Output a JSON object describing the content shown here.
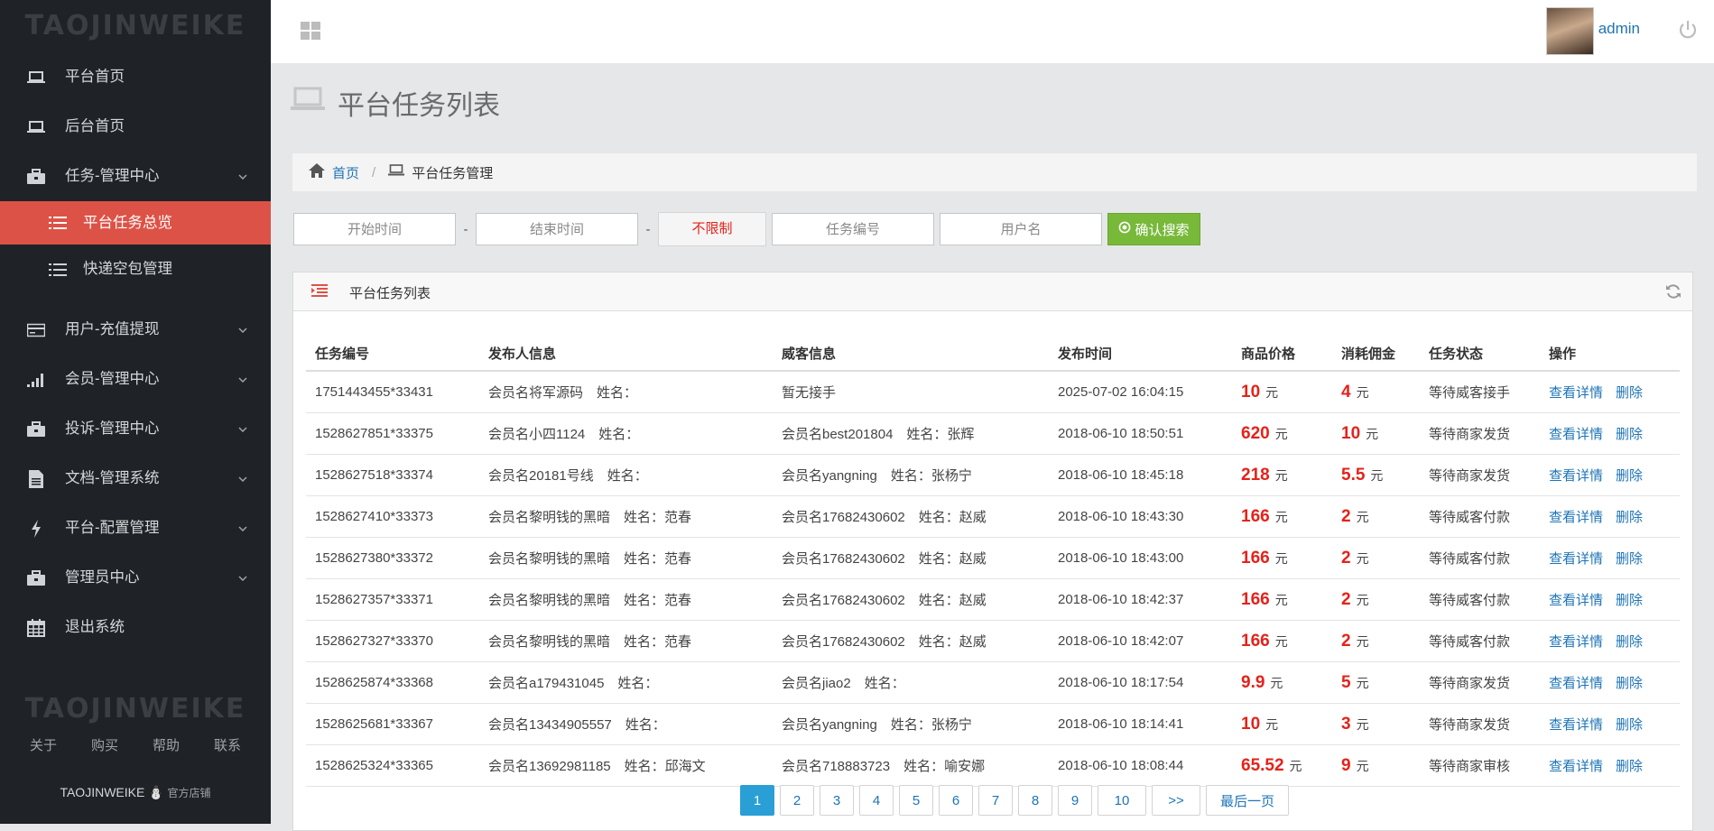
{
  "brand": "TAOJINWEIKE",
  "sidebar": {
    "items": [
      {
        "label": "平台首页",
        "icon": "laptop-icon"
      },
      {
        "label": "后台首页",
        "icon": "laptop-icon"
      },
      {
        "label": "任务-管理中心",
        "icon": "briefcase-icon"
      },
      {
        "label": "平台任务总览",
        "icon": "list-icon"
      },
      {
        "label": "快递空包管理",
        "icon": "list-icon"
      },
      {
        "label": "用户-充值提现",
        "icon": "card-icon"
      },
      {
        "label": "会员-管理中心",
        "icon": "signal-icon"
      },
      {
        "label": "投诉-管理中心",
        "icon": "briefcase-icon"
      },
      {
        "label": "文档-管理系统",
        "icon": "document-icon"
      },
      {
        "label": "平台-配置管理",
        "icon": "bolt-icon"
      },
      {
        "label": "管理员中心",
        "icon": "briefcase-icon"
      },
      {
        "label": "退出系统",
        "icon": "calendar-icon"
      }
    ],
    "footer_brand": "TAOJINWEIKE",
    "footer_links": [
      "关于",
      "购买",
      "帮助",
      "联系"
    ],
    "shop_name": "TAOJINWEIKE",
    "shop_label": "官方店铺"
  },
  "topbar": {
    "username": "admin"
  },
  "page": {
    "title": "平台任务列表"
  },
  "breadcrumb": {
    "home": "首页",
    "current": "平台任务管理"
  },
  "filters": {
    "start_placeholder": "开始时间",
    "end_placeholder": "结束时间",
    "dash": "-",
    "limit_value": "不限制",
    "task_no_placeholder": "任务编号",
    "username_placeholder": "用户名",
    "search_label": "确认搜索"
  },
  "panel": {
    "title": "平台任务列表"
  },
  "table": {
    "headers": [
      "任务编号",
      "发布人信息",
      "威客信息",
      "发布时间",
      "商品价格",
      "消耗佣金",
      "任务状态",
      "操作"
    ],
    "currency": "元",
    "view_label": "查看详情",
    "delete_label": "删除",
    "rows": [
      {
        "id": "1751443455*33431",
        "publisher": "会员名将军源码　姓名：",
        "worker": "暂无接手",
        "time": "2025-07-02 16:04:15",
        "price": "10",
        "commission": "4",
        "status": "等待威客接手"
      },
      {
        "id": "1528627851*33375",
        "publisher": "会员名小四1124　姓名：",
        "worker": "会员名best201804　姓名：张辉",
        "time": "2018-06-10 18:50:51",
        "price": "620",
        "commission": "10",
        "status": "等待商家发货"
      },
      {
        "id": "1528627518*33374",
        "publisher": "会员名20181号线　姓名：",
        "worker": "会员名yangning　姓名：张杨宁",
        "time": "2018-06-10 18:45:18",
        "price": "218",
        "commission": "5.5",
        "status": "等待商家发货"
      },
      {
        "id": "1528627410*33373",
        "publisher": "会员名黎明钱的黑暗　姓名：范春",
        "worker": "会员名17682430602　姓名：赵威",
        "time": "2018-06-10 18:43:30",
        "price": "166",
        "commission": "2",
        "status": "等待威客付款"
      },
      {
        "id": "1528627380*33372",
        "publisher": "会员名黎明钱的黑暗　姓名：范春",
        "worker": "会员名17682430602　姓名：赵威",
        "time": "2018-06-10 18:43:00",
        "price": "166",
        "commission": "2",
        "status": "等待威客付款"
      },
      {
        "id": "1528627357*33371",
        "publisher": "会员名黎明钱的黑暗　姓名：范春",
        "worker": "会员名17682430602　姓名：赵威",
        "time": "2018-06-10 18:42:37",
        "price": "166",
        "commission": "2",
        "status": "等待威客付款"
      },
      {
        "id": "1528627327*33370",
        "publisher": "会员名黎明钱的黑暗　姓名：范春",
        "worker": "会员名17682430602　姓名：赵威",
        "time": "2018-06-10 18:42:07",
        "price": "166",
        "commission": "2",
        "status": "等待威客付款"
      },
      {
        "id": "1528625874*33368",
        "publisher": "会员名a179431045　姓名：",
        "worker": "会员名jiao2　姓名：",
        "time": "2018-06-10 18:17:54",
        "price": "9.9",
        "commission": "5",
        "status": "等待商家发货"
      },
      {
        "id": "1528625681*33367",
        "publisher": "会员名13434905557　姓名：",
        "worker": "会员名yangning　姓名：张杨宁",
        "time": "2018-06-10 18:14:41",
        "price": "10",
        "commission": "3",
        "status": "等待商家发货"
      },
      {
        "id": "1528625324*33365",
        "publisher": "会员名13692981185　姓名：邱海文",
        "worker": "会员名718883723　姓名：喻安娜",
        "time": "2018-06-10 18:08:44",
        "price": "65.52",
        "commission": "9",
        "status": "等待商家审核"
      }
    ]
  },
  "pagination": {
    "pages": [
      "1",
      "2",
      "3",
      "4",
      "5",
      "6",
      "7",
      "8",
      "9",
      "10"
    ],
    "current": "1",
    "next": ">>",
    "last": "最后一页"
  },
  "colors": {
    "sidebar_bg": "#1f2327",
    "active": "#dd5246",
    "accent_blue": "#1e74b6",
    "price_red": "#e5221a",
    "search_green": "#78b93a",
    "page_active": "#2a9fd6"
  }
}
